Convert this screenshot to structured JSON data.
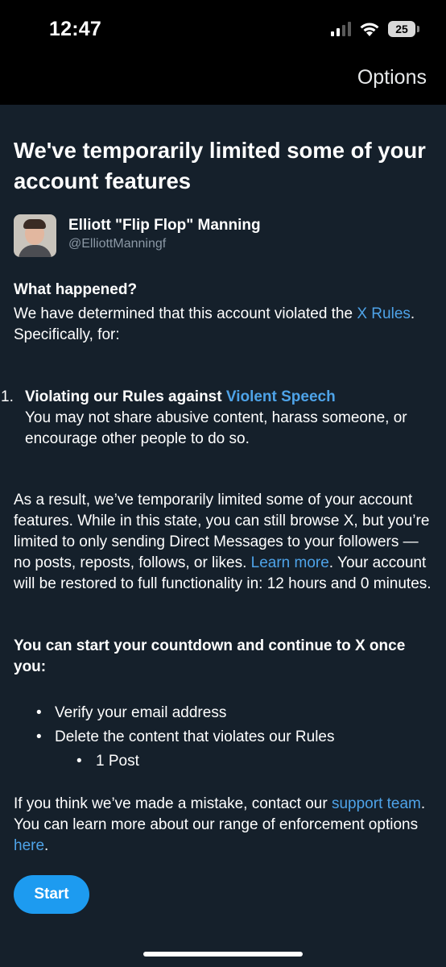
{
  "status_bar": {
    "time": "12:47",
    "battery": "25"
  },
  "nav": {
    "options_label": "Options"
  },
  "title": "We've temporarily limited some of your account features",
  "user": {
    "name": "Elliott \"Flip Flop\" Manning",
    "handle": "@ElliottManningf"
  },
  "what_happened": {
    "heading": "What happened?",
    "text_before_link": "We have determined that this account violated the ",
    "rules_link": "X Rules",
    "text_after_link": ". Specifically, for:"
  },
  "violation": {
    "number": "1.",
    "title_prefix": "Violating our Rules against ",
    "title_link": "Violent Speech",
    "description": "You may not share abusive content, harass someone, or encourage other people to do so."
  },
  "result": {
    "text_before_link": "As a result, we’ve temporarily limited some of your account features. While in this state, you can still browse X, but you’re limited to only sending Direct Messages to your followers — no posts, reposts, follows, or likes. ",
    "learn_more_link": "Learn more",
    "text_after_link": ". Your account will be restored to full functionality in: 12 hours and 0 minutes."
  },
  "countdown": {
    "heading": "You can start your countdown and continue to X once you:",
    "items": [
      "Verify your email address",
      "Delete the content that violates our Rules"
    ],
    "subitems": [
      "1 Post"
    ]
  },
  "mistake": {
    "text_before_link": "If you think we’ve made a mistake, contact our ",
    "support_link": "support team",
    "text_middle": ". You can learn more about our range of enforcement options ",
    "here_link": "here",
    "text_end": "."
  },
  "start_button": "Start",
  "colors": {
    "background": "#15202b",
    "accent": "#1d9bf0",
    "link": "#4ea3e8"
  }
}
